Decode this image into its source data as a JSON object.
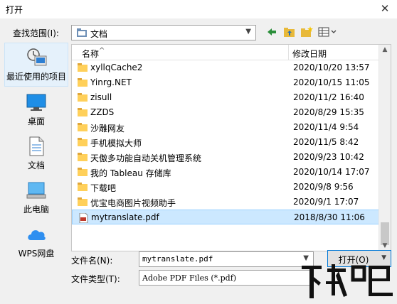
{
  "window": {
    "title": "打开",
    "close_glyph": "✕"
  },
  "lookin": {
    "label": "查找范围(I):",
    "value": "文档",
    "icon": "folder-documents-icon"
  },
  "toolbar": {
    "back_icon": "arrow-left-icon",
    "up_icon": "folder-up-icon",
    "new_folder_icon": "new-folder-icon",
    "view_icon": "view-menu-icon"
  },
  "places": [
    {
      "label": "最近使用的项目",
      "icon": "recent-icon",
      "selected": true
    },
    {
      "label": "桌面",
      "icon": "desktop-icon",
      "selected": false
    },
    {
      "label": "文档",
      "icon": "documents-icon",
      "selected": false
    },
    {
      "label": "此电脑",
      "icon": "computer-icon",
      "selected": false
    },
    {
      "label": "WPS网盘",
      "icon": "cloud-icon",
      "selected": false
    }
  ],
  "filelist": {
    "col_name": "名称",
    "col_date": "修改日期",
    "rows": [
      {
        "name": "xyllqCache2",
        "date": "2020/10/20 13:57",
        "type": "folder"
      },
      {
        "name": "Yinrg.NET",
        "date": "2020/10/15 11:05",
        "type": "folder"
      },
      {
        "name": "zisull",
        "date": "2020/11/2 16:40",
        "type": "folder"
      },
      {
        "name": "ZZDS",
        "date": "2020/8/29 15:35",
        "type": "folder"
      },
      {
        "name": "沙雕网友",
        "date": "2020/11/4 9:54",
        "type": "folder"
      },
      {
        "name": "手机模拟大师",
        "date": "2020/11/5 8:42",
        "type": "folder"
      },
      {
        "name": "天傲多功能自动关机管理系统",
        "date": "2020/9/23 10:42",
        "type": "folder"
      },
      {
        "name": "我的 Tableau 存储库",
        "date": "2020/10/14 17:07",
        "type": "folder"
      },
      {
        "name": "下载吧",
        "date": "2020/9/8 9:56",
        "type": "folder"
      },
      {
        "name": "优宝电商图片视频助手",
        "date": "2020/9/1 17:07",
        "type": "folder"
      },
      {
        "name": "mytranslate.pdf",
        "date": "2018/8/30 11:06",
        "type": "pdf",
        "selected": true
      }
    ]
  },
  "filename": {
    "label": "文件名(N):",
    "value": "mytranslate.pdf"
  },
  "filetype": {
    "label": "文件类型(T):",
    "value": "Adobe PDF Files (*.pdf)"
  },
  "open_button": {
    "label": "打开(O)"
  },
  "colors": {
    "selected_row": "#cce8ff",
    "accent": "#0078d7",
    "folder": "#ffd05a"
  }
}
